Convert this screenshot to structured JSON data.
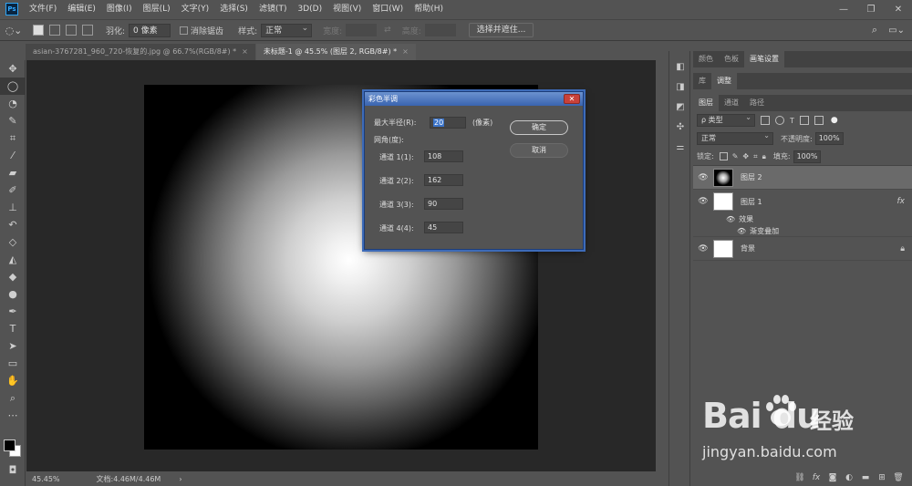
{
  "menubar": {
    "app_icon": "Ps",
    "items": [
      "文件(F)",
      "编辑(E)",
      "图像(I)",
      "图层(L)",
      "文字(Y)",
      "选择(S)",
      "滤镜(T)",
      "3D(D)",
      "视图(V)",
      "窗口(W)",
      "帮助(H)"
    ]
  },
  "window_controls": {
    "minimize": "—",
    "restore": "❐",
    "close": "✕"
  },
  "options": {
    "feather_label": "羽化:",
    "feather_value": "0 像素",
    "antialias_label": "消除锯齿",
    "style_label": "样式:",
    "style_value": "正常",
    "width_label": "宽度:",
    "height_label": "高度:",
    "select_mask_button": "选择并遮住..."
  },
  "tabs": [
    {
      "label": "asian-3767281_960_720-恢复的.jpg @ 66.7%(RGB/8#) *",
      "active": false
    },
    {
      "label": "未标题-1 @ 45.5% (图层 2, RGB/8#) *",
      "active": true
    }
  ],
  "tab_close": "×",
  "status": {
    "zoom": "45.45%",
    "doc": "文档:4.46M/4.46M"
  },
  "dialog": {
    "title": "彩色半调",
    "max_radius_label": "最大半径(R):",
    "max_radius_value": "20",
    "max_radius_unit": "(像素)",
    "screen_angles_label": "网角(度):",
    "channels": [
      {
        "label": "通道 1(1):",
        "value": "108"
      },
      {
        "label": "通道 2(2):",
        "value": "162"
      },
      {
        "label": "通道 3(3):",
        "value": "90"
      },
      {
        "label": "通道 4(4):",
        "value": "45"
      }
    ],
    "ok_button": "确定",
    "cancel_button": "取消",
    "close": "✕"
  },
  "panels": {
    "top_tabs": [
      "颜色",
      "色板",
      "画笔设置"
    ],
    "mid_tabs": [
      "库",
      "调整"
    ],
    "layer_tabs": [
      "图层",
      "通道",
      "路径"
    ],
    "kind_label": "ρ 类型",
    "blend_mode": "正常",
    "opacity_label": "不透明度:",
    "opacity_value": "100%",
    "lock_label": "锁定:",
    "fill_label": "填充:",
    "fill_value": "100%",
    "layers": [
      {
        "name": "图层 2",
        "active": true,
        "thumb": "glow"
      },
      {
        "name": "图层 1",
        "active": false,
        "thumb": "white",
        "fx": "fx"
      },
      {
        "name": "背景",
        "active": false,
        "thumb": "white",
        "lock": true
      }
    ],
    "effects_label": "效果",
    "effect_item": "渐变叠加"
  },
  "watermark": {
    "brand": "Bai du",
    "cn": "经验",
    "url": "jingyan.baidu.com"
  },
  "colors": {
    "ui_bg": "#535353",
    "canvas_bg": "#282828",
    "dialog_title": "#3a64b0",
    "accent": "#3b74c9"
  }
}
